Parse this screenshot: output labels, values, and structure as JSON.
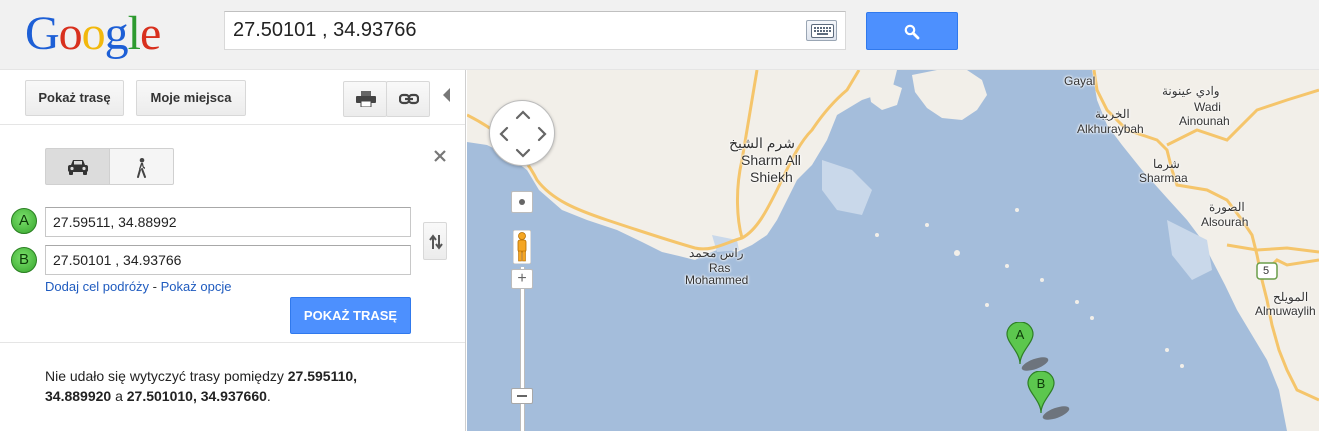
{
  "header": {
    "logo_letters": [
      "G",
      "o",
      "o",
      "g",
      "l",
      "e"
    ],
    "logo_colors": [
      "#1d5fd6",
      "#d8301e",
      "#f2b80c",
      "#1d5fd6",
      "#2d9a2f",
      "#d8301e"
    ],
    "search_value": "27.50101 , 34.93766",
    "keyboard_icon": "keyboard-icon",
    "search_icon": "search-icon",
    "accent_color": "#4d90fe"
  },
  "toolbar": {
    "route_tab": "Pokaż trasę",
    "places_tab": "Moje miejsca",
    "print_icon": "print-icon",
    "link_icon": "link-icon"
  },
  "directions": {
    "modes": [
      "car-icon",
      "walk-icon"
    ],
    "waypoint_a_marker": "A",
    "waypoint_a_value": "27.59511, 34.88992",
    "waypoint_b_marker": "B",
    "waypoint_b_value": "27.50101 , 34.93766",
    "add_destination": "Dodaj cel podróży",
    "separator": " - ",
    "show_options": "Pokaż opcje",
    "submit_label": "POKAŻ TRASĘ"
  },
  "error": {
    "prefix": "Nie udało się wytyczyć trasy pomiędzy ",
    "from": "27.595110, 34.889920",
    "middle": " a ",
    "to": "27.501010, 34.937660",
    "suffix": "."
  },
  "map": {
    "water_color": "#a4bddb",
    "land_color": "#f2efe9",
    "road_color": "#f5c56b",
    "labels": {
      "gayal": "Gayal",
      "wadi_ar": "وادي عينونة",
      "wadi_1": "Wadi",
      "wadi_2": "Ainounah",
      "khuraybah_ar": "الخريبة",
      "khuraybah": "Alkhuraybah",
      "sharm_ar": "شرم الشيخ",
      "sharm_1": "Sharm All",
      "sharm_2": "Shiekh",
      "sharmaa_ar": "شرما",
      "sharmaa": "Sharmaa",
      "sourah_ar": "الصورة",
      "sourah": "Alsourah",
      "ras_ar": "راس محمد",
      "ras_1": "Ras",
      "ras_2": "Mohammed",
      "route_shield": "5",
      "muwaylih_ar": "المويلح",
      "muwaylih": "Almuwaylih"
    },
    "pins": [
      "A",
      "B"
    ]
  }
}
